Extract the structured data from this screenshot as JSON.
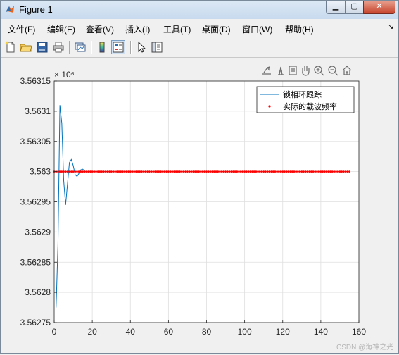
{
  "window": {
    "title": "Figure 1"
  },
  "menu": {
    "items": [
      "文件(F)",
      "编辑(E)",
      "查看(V)",
      "插入(I)",
      "工具(T)",
      "桌面(D)",
      "窗口(W)",
      "帮助(H)"
    ]
  },
  "toolbar": {
    "icons": [
      "new-figure-icon",
      "open-file-icon",
      "save-icon",
      "print-icon",
      "link-plot-icon",
      "insert-colorbar-icon",
      "insert-legend-icon",
      "edit-plot-arrow-icon",
      "property-inspector-icon"
    ]
  },
  "axes_toolbar": {
    "icons": [
      "export-icon",
      "brush-icon",
      "data-tips-icon",
      "pan-hand-icon",
      "zoom-in-icon",
      "zoom-out-icon",
      "home-restore-view-icon"
    ]
  },
  "chart_data": {
    "type": "line",
    "title": "",
    "xlabel": "",
    "ylabel": "",
    "xlim": [
      0,
      160
    ],
    "ylim": [
      3562750,
      3563150
    ],
    "x_ticks": [
      0,
      20,
      40,
      60,
      80,
      100,
      120,
      140,
      160
    ],
    "y_ticks": [
      3562750,
      3562800,
      3562850,
      3562900,
      3562950,
      3563000,
      3563050,
      3563100,
      3563150
    ],
    "y_tick_labels": [
      "3.56275",
      "3.5628",
      "3.56285",
      "3.5629",
      "3.56295",
      "3.563",
      "3.56305",
      "3.5631",
      "3.56315"
    ],
    "y_exponent_label": "× 10⁶",
    "grid": true,
    "legend": "top-right",
    "series": [
      {
        "name": "锁相环跟踪",
        "style": "line",
        "color": "#0072BD",
        "x": [
          1,
          2,
          3,
          4,
          5,
          6,
          7,
          8,
          9,
          10,
          11,
          12,
          13,
          14,
          15,
          16,
          17,
          18,
          19,
          20,
          22,
          25,
          30
        ],
        "values": [
          3562775,
          3562880,
          3563110,
          3563080,
          3562985,
          3562945,
          3562980,
          3563015,
          3563020,
          3563010,
          3562995,
          3562992,
          3562997,
          3563003,
          3563004,
          3563001,
          3562999,
          3563000,
          3563000,
          3563000,
          3563000,
          3563000,
          3563000
        ]
      },
      {
        "name": "实际的载波频率",
        "style": "points",
        "color": "#ff0000",
        "x_range": [
          0,
          155
        ],
        "x_step": 1,
        "value": 3563000
      }
    ]
  },
  "watermark": "CSDN @海神之光"
}
